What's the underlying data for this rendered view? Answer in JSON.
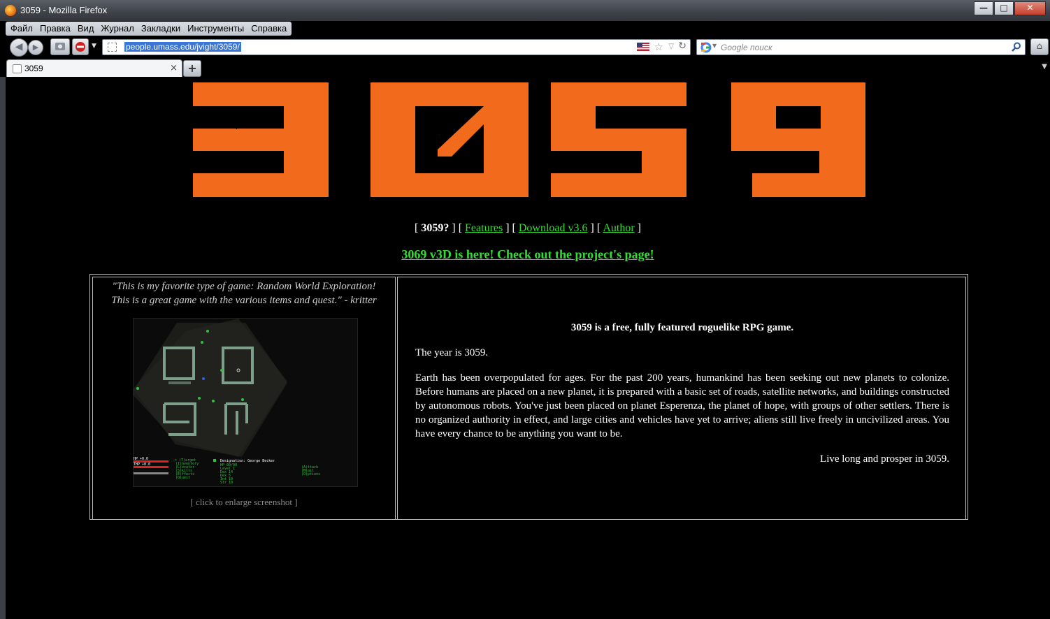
{
  "window": {
    "title": "3059 - Mozilla Firefox",
    "min_glyph": "—",
    "max_glyph": "□",
    "close_glyph": "✕"
  },
  "menubar": {
    "items": [
      "Файл",
      "Правка",
      "Вид",
      "Журнал",
      "Закладки",
      "Инструменты",
      "Справка"
    ]
  },
  "navbar": {
    "back_glyph": "◀",
    "forward_glyph": "▶",
    "url": "people.umass.edu/jvight/3059/",
    "search_placeholder": "Google поиск",
    "home_glyph": "⌂"
  },
  "tabs": {
    "active_title": "3059",
    "close_glyph": "×",
    "new_tab_glyph": "+"
  },
  "site": {
    "logo_text": "3059",
    "logo_color": "#f26a1b",
    "link_color": "#33dd33",
    "nav": {
      "current": "3059?",
      "features": "Features",
      "download": "Download v3.6",
      "author": "Author"
    },
    "announcement": "3069 v3D is here! Check out the project's page!",
    "quote_line1": "\"This is my favorite type of game: Random World Exploration!",
    "quote_line2": "This is a great game with the various items and quest.\" - kritter",
    "enlarge_link": "[ click to enlarge screenshot ]",
    "desc_title": "3059 is a free, fully featured roguelike RPG game.",
    "desc_p1": "The year is 3059.",
    "desc_p2": "Earth has been overpopulated for ages. For the past 200 years, humankind has been seeking out new planets to colonize. Before humans are placed on a new planet, it is prepared with a basic set of roads, satellite networks, and buildings constructed by autonomous robots. You've just been placed on planet Esperenza, the planet of hope, with groups of other settlers. There is no organized authority in effect, and large cities and vehicles have yet to arrive; aliens still live freely in uncivilized areas. You have every chance to be anything you want to be.",
    "desc_p3": "Live long and prosper in 3059."
  },
  "screenshot": {
    "stats_lines": [
      "HP  +0.0",
      "THP +0.0"
    ],
    "menu_lines": [
      "-> (T)arget",
      "(I)nventory",
      "(L)ocator",
      "(S)kills",
      "(E)ffects",
      "(Q)uest"
    ],
    "info_lines": [
      "Designation: George Becker",
      "HP 00/00",
      "Level 1",
      "Dex 14",
      "Dex 5",
      "Int 10",
      "Str 10"
    ],
    "action_lines": [
      "(A)ttack",
      "(M)ail",
      "(O)ptions"
    ]
  }
}
